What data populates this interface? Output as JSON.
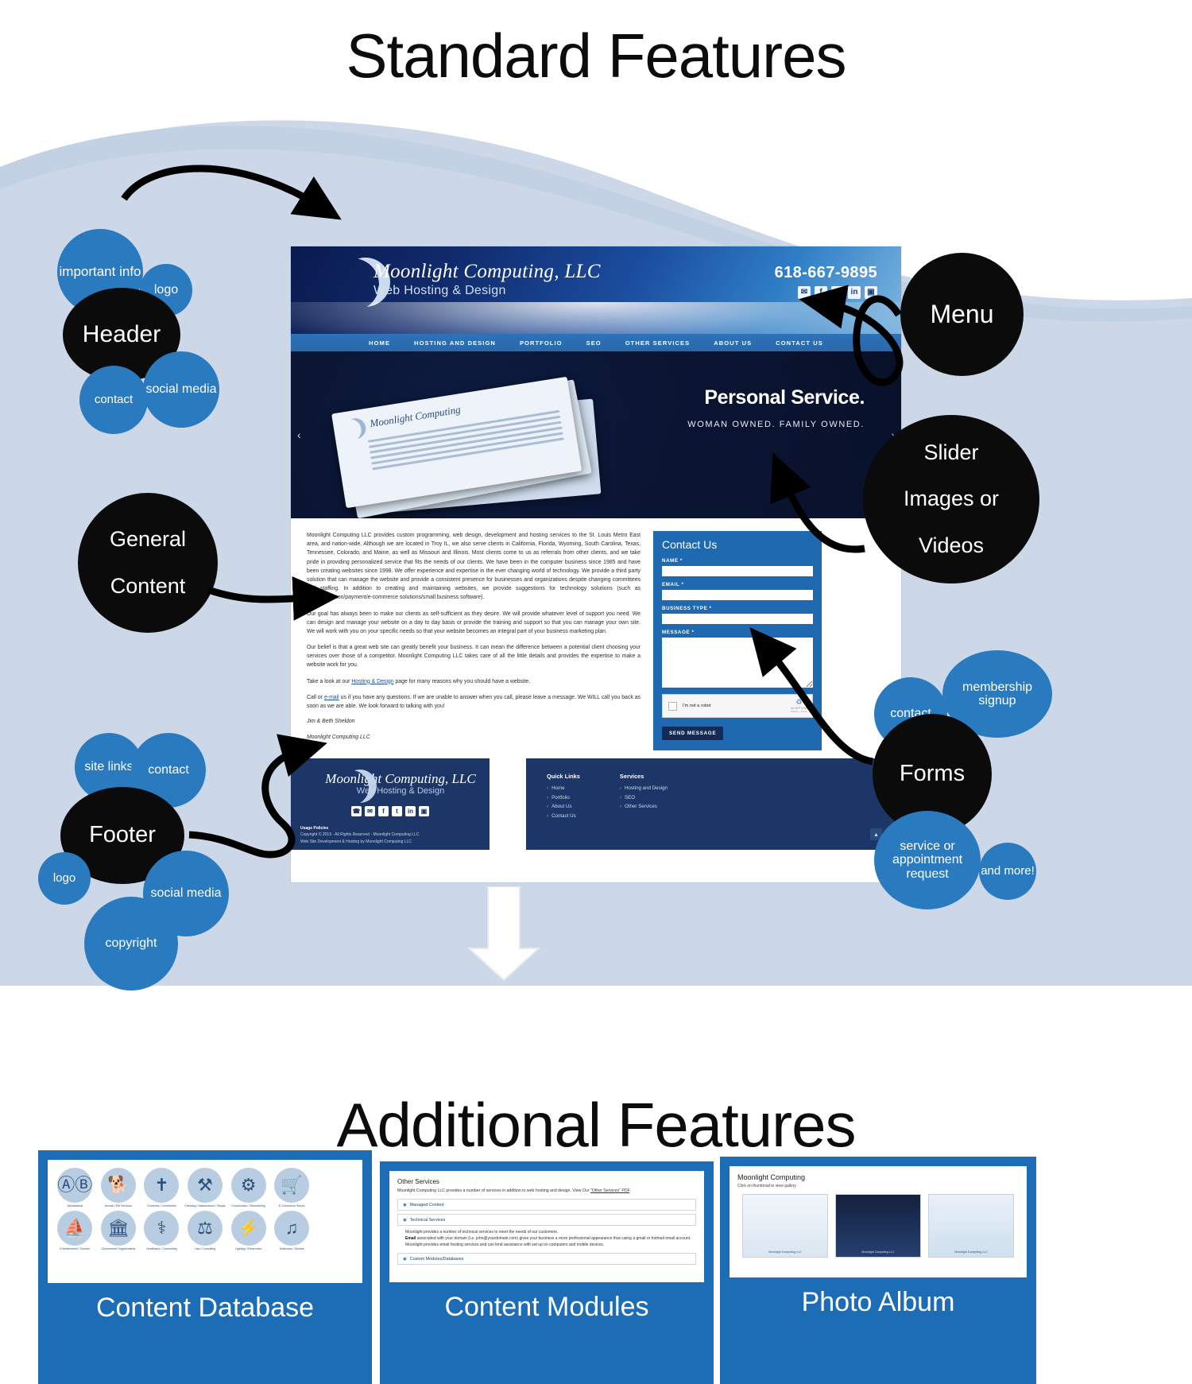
{
  "headings": {
    "main": "Standard Features",
    "secondary": "Additional Features"
  },
  "colors": {
    "bubble_blue": "#2a7ac0",
    "bubble_black": "#0b0b0b",
    "site_nav_blue": "#2e72b8",
    "form_blue": "#1f69b0",
    "footer_navy": "#1c3668",
    "panel_blue": "#1c6db5",
    "background_blue": "#ccd8e8"
  },
  "callouts": {
    "header": {
      "main": "Header",
      "items": [
        "important info",
        "logo",
        "contact",
        "social media"
      ]
    },
    "general_content": {
      "main_line1": "General",
      "main_line2": "Content"
    },
    "menu": {
      "main": "Menu"
    },
    "slider": {
      "line1": "Slider",
      "line2": "Images or",
      "line3": "Videos"
    },
    "forms": {
      "main": "Forms",
      "items": [
        "contact",
        "membership signup",
        "service or appointment request",
        "and more!"
      ]
    },
    "footer": {
      "main": "Footer",
      "items": [
        "site links",
        "contact",
        "logo",
        "social media",
        "copyright"
      ]
    }
  },
  "site": {
    "header": {
      "brand_line1": "Moonlight Computing, LLC",
      "brand_line2": "Web Hosting & Design",
      "phone": "618-667-9895",
      "social": [
        "✉",
        "f",
        "t",
        "in",
        "▣"
      ]
    },
    "nav": [
      "HOME",
      "HOSTING AND DESIGN",
      "PORTFOLIO",
      "SEO",
      "OTHER SERVICES",
      "ABOUT US",
      "CONTACT US"
    ],
    "hero": {
      "title": "Personal Service.",
      "subtitle": "WOMAN OWNED. FAMILY OWNED.",
      "prev": "‹",
      "next": "›",
      "card_brand": "Moonlight Computing"
    },
    "content": {
      "paragraphs": [
        "Moonlight Computing LLC provides custom programming, web design, development and hosting services to the St. Louis Metro East area, and nation-wide. Although we are located in Troy IL, we also serve clients in California, Florida, Wyoming, South Carolina, Texas, Tennessee, Colorado, and Maine, as well as Missouri and Illinois.  Most clients come to us as referrals from other clients, and we take pride in providing personalized service that fits the needs of our clients.  We have been in the computer business since 1985 and have been creating websites since 1998.  We offer experience and expertise in the ever changing world of technology. We provide a third party solution that can manage the website and provide a consistent presence for businesses and organizations despite changing committees and staffing. In addition to creating and maintaining websites, we provide suggestions for technology solutions (such as giving/donation/payment/e-commerce solutions/small business software).",
        "Our goal has always been to make our clients as self-sufficient as they desire. We will provide whatever level of support you need. We can design and manage your website on a day to day basis or provide the training and support so that you can manage your own site. We will work with you on your specific needs so that your website becomes an integral part of your business marketing plan.",
        "Our belief is that a great web site can greatly benefit your business. It can mean the difference between a potential client choosing your services over those of a competitor. Moonlight Computing LLC takes care of all the little details and provides the expertise to make a website work for you."
      ],
      "take_a_look_pre": "Take a look at our ",
      "take_a_look_link": "Hosting & Design",
      "take_a_look_post": " page for many reasons why you should have a website.",
      "call_pre": "Call or ",
      "call_link": "e-mail",
      "call_post": " us if you have any questions.  If we are unable to answer when you call, please leave a message.  We WILL call you back as soon as we are able.  We look forward to talking with you!",
      "signature_1": "Jim & Beth Sheldon",
      "signature_2": "Moonlight Computing LLC"
    },
    "form": {
      "title": "Contact Us",
      "labels": [
        "NAME *",
        "EMAIL *",
        "BUSINESS TYPE *",
        "MESSAGE *"
      ],
      "captcha_text": "I'm not a robot",
      "captcha_brand": "reCAPTCHA",
      "captcha_terms": "Privacy - Terms",
      "submit": "SEND MESSAGE"
    },
    "footer": {
      "brand_line1": "Moonlight Computing, LLC",
      "brand_line2": "Web Hosting & Design",
      "social": [
        "☎",
        "✉",
        "f",
        "t",
        "in",
        "▣"
      ],
      "usage_policies": "Usage Policies",
      "copyright": "Copyright © 2019 · All Rights Reserved · Moonlight Computing LLC",
      "developed_by": "Web Site Development & Hosting by Moonlight Computing LLC",
      "quick_links_title": "Quick Links",
      "quick_links": [
        "Home",
        "Portfolio",
        "About Us",
        "Contact Us"
      ],
      "services_title": "Services",
      "services": [
        "Hosting and Design",
        "SEO",
        "Other Services"
      ],
      "to_top": "▴"
    }
  },
  "features": {
    "content_database": {
      "caption": "Content Database",
      "icons": [
        {
          "glyph": "ⓐ",
          "label": "Alphabetical"
        },
        {
          "glyph": "ὁ5",
          "label": "Animal / Pet Services"
        },
        {
          "glyph": "✝",
          "label": "Churches / Cemeteries"
        },
        {
          "glyph": "⚒",
          "label": "Cleaning / Maintenance / Repair"
        },
        {
          "glyph": "⚙",
          "label": "Construction / Remodeling"
        },
        {
          "glyph": "⛺",
          "label": "E-Commerce Stores"
        },
        {
          "glyph": "⛵",
          "label": "Entertainment / Tourism"
        },
        {
          "glyph": "Ἵb",
          "label": "Government Organizations"
        },
        {
          "glyph": "⚕",
          "label": "Healthcare / Counseling"
        },
        {
          "glyph": "⚖",
          "label": "Law / Consulting"
        },
        {
          "glyph": "⚡",
          "label": "Lighting / Electronics"
        },
        {
          "glyph": "♫",
          "label": "Musicians / Studios"
        }
      ]
    },
    "content_modules": {
      "caption": "Content Modules",
      "title": "Other Services",
      "subtitle_pre": "Moonlight Computing LLC provides a number of services in addition to web hosting and design. View Our ",
      "subtitle_link": "\"Other Services\" PDF",
      "subtitle_post": ".",
      "rows": [
        "Managed Content",
        "Technical Services",
        "Custom Modules/Databases"
      ],
      "body_line1": "Moonlight provides a number of technical services to meet the needs of our customers.",
      "body_line2_bold": "Email",
      "body_line2": " associated with your domain (i.e. john@yourdomain.com) gives your business a more professional appearance than using a gmail or hotmail email account.",
      "body_line3": "Moonlight provides email hosting services and can lend assistance with set up on computers and mobile devices."
    },
    "photo_album": {
      "caption": "Photo Album",
      "title": "Moonlight Computing",
      "subtitle": "Click on thumbnail to view gallery",
      "thumbs": [
        "Moonlight Computing LLC",
        "Moonlight Computing LLC",
        "Moonlight Computing LLC"
      ]
    }
  }
}
